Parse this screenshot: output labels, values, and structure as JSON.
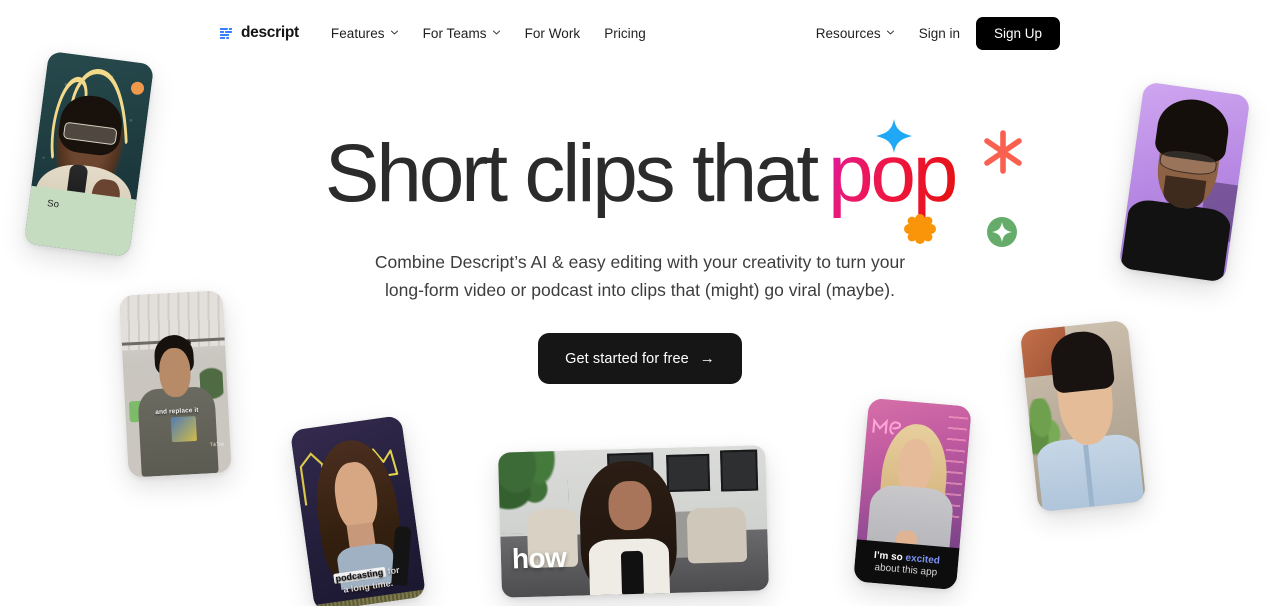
{
  "meta": {
    "page_title": "Descript — Short clips that pop",
    "background_color": "#ffffff"
  },
  "navbar": {
    "logo": {
      "icon": "descript-bars-logo-icon",
      "wordmark": "descript",
      "color": "#1a6dff"
    },
    "links": [
      {
        "label": "Features",
        "has_dropdown": true,
        "icon": "chevron-down-icon"
      },
      {
        "label": "For Teams",
        "has_dropdown": true,
        "icon": "chevron-down-icon"
      },
      {
        "label": "For Work",
        "has_dropdown": false,
        "icon": ""
      },
      {
        "label": "Pricing",
        "has_dropdown": false,
        "icon": ""
      }
    ],
    "right": {
      "resources": {
        "label": "Resources",
        "has_dropdown": true,
        "icon": "chevron-down-icon"
      },
      "sign_in_label": "Sign in",
      "sign_up_label": "Sign Up",
      "sign_up_bg": "#000000",
      "sign_up_text_color": "#ffffff"
    }
  },
  "hero": {
    "headline_plain": "Short clips that",
    "headline_accent": "pop",
    "headline_color": "#2b2b2b",
    "accent_gradient_from": "#d11ad1",
    "accent_gradient_to": "#e41111",
    "subhead_line1": "Combine Descript’s AI & easy editing with your creativity to turn your",
    "subhead_line2": "long-form video or podcast into clips that (might) go viral (maybe).",
    "subhead_color": "#3d3d3d",
    "cta": {
      "label": "Get started for free",
      "arrow": "→",
      "bg": "#161616",
      "text_color": "#ffffff"
    },
    "decorations": [
      {
        "name": "blue-four-point-star-icon",
        "color": "#1fa8f5"
      },
      {
        "name": "coral-asterisk-icon",
        "color": "#f9604f"
      },
      {
        "name": "orange-flower-blob-icon",
        "color": "#fa9408"
      },
      {
        "name": "green-circle-sparkle-icon",
        "color": "#65ac6b"
      }
    ]
  },
  "cards": [
    {
      "id": "podcaster-so",
      "description": "Woman with patterned glasses speaking into a microphone, dark teal starry backdrop with a yellow neon squiggle",
      "caption": "So",
      "caption_bar_color": "#c5dcc0",
      "caption_text_color": "#1b1b1b",
      "accent_dot_color": "#f0994a"
    },
    {
      "id": "loft-man",
      "description": "Man in a grey graphic t-shirt standing in a bright loft office",
      "caption": "and replace it",
      "watermark": "TikTok"
    },
    {
      "id": "podcasting-woman",
      "description": "Woman with long wavy brown hair at a microphone, navy backdrop with a yellow crown graphic",
      "caption_highlight": "podcasting",
      "caption_rest": " for",
      "caption_line2": "a long time."
    },
    {
      "id": "how-landscape",
      "description": "Woman with long curly hair seated on a grey couch with a plant and framed photos behind her",
      "caption": "how",
      "caption_text_color": "#ffffff"
    },
    {
      "id": "excited-blonde",
      "description": "Blonde woman in a grey sweater in front of a pink neon sign",
      "caption_l1_a": "I’m so ",
      "caption_l1_b": "excited",
      "caption_l2": "about this app",
      "caption_box_color": "#0d0d0d",
      "caption_highlight_color": "#7b93f2"
    },
    {
      "id": "blueshirt-person",
      "description": "Person in a light blue button-up shirt outdoors with greenery behind",
      "caption": ""
    },
    {
      "id": "purple-man",
      "description": "Man with glasses in a black tee on a lavender purple backdrop",
      "caption": ""
    }
  ]
}
